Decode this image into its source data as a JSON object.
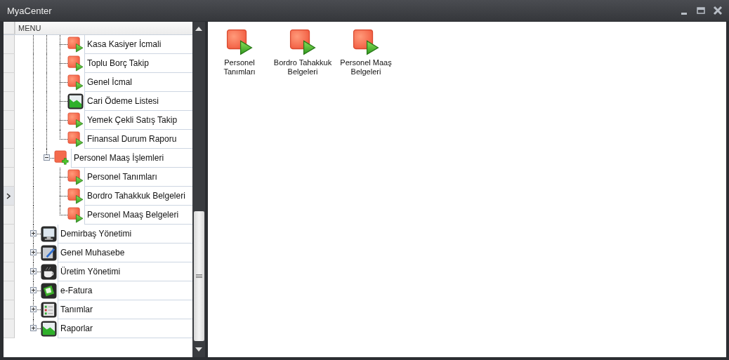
{
  "window": {
    "title": "MyaCenter"
  },
  "menu": {
    "header": "MENU",
    "tree": [
      {
        "children": [
          {
            "children": [
              {
                "label": "Kasa Kasiyer İcmali",
                "kind": "report",
                "selected": false
              },
              {
                "label": "Toplu Borç Takip",
                "kind": "report",
                "selected": false
              },
              {
                "label": "Genel İcmal",
                "kind": "report",
                "selected": false
              },
              {
                "label": "Cari Ödeme Listesi",
                "kind": "chart",
                "selected": false
              },
              {
                "label": "Yemek Çekli Satış Takip",
                "kind": "report",
                "selected": false
              },
              {
                "label": "Finansal Durum Raporu",
                "kind": "report",
                "selected": false
              }
            ]
          },
          {
            "label": "Personel Maaş İşlemleri",
            "kind": "group",
            "selected": false,
            "expanded": true,
            "children": [
              {
                "label": "Personel Tanımları",
                "kind": "report",
                "selected": false
              },
              {
                "label": "Bordro Tahakkuk Belgeleri",
                "kind": "report",
                "selected": true
              },
              {
                "label": "Personel Maaş Belgeleri",
                "kind": "report",
                "selected": false
              }
            ]
          }
        ]
      },
      {
        "label": "Demirbaş Yönetimi",
        "kind": "monitor",
        "selected": false,
        "expanded": false
      },
      {
        "label": "Genel Muhasebe",
        "kind": "pen",
        "selected": false,
        "expanded": false
      },
      {
        "label": "Üretim Yönetimi",
        "kind": "cup",
        "selected": false,
        "expanded": false
      },
      {
        "label": "e-Fatura",
        "kind": "invoice",
        "selected": false,
        "expanded": false
      },
      {
        "label": "Tanımlar",
        "kind": "list",
        "selected": false,
        "expanded": false
      },
      {
        "label": "Raporlar",
        "kind": "chart",
        "selected": false,
        "expanded": false
      }
    ]
  },
  "shortcuts": [
    {
      "label": "Personel Tanımları",
      "kind": "report"
    },
    {
      "label": "Bordro Tahakkuk Belgeleri",
      "kind": "report"
    },
    {
      "label": "Personel Maaş Belgeleri",
      "kind": "report"
    }
  ]
}
